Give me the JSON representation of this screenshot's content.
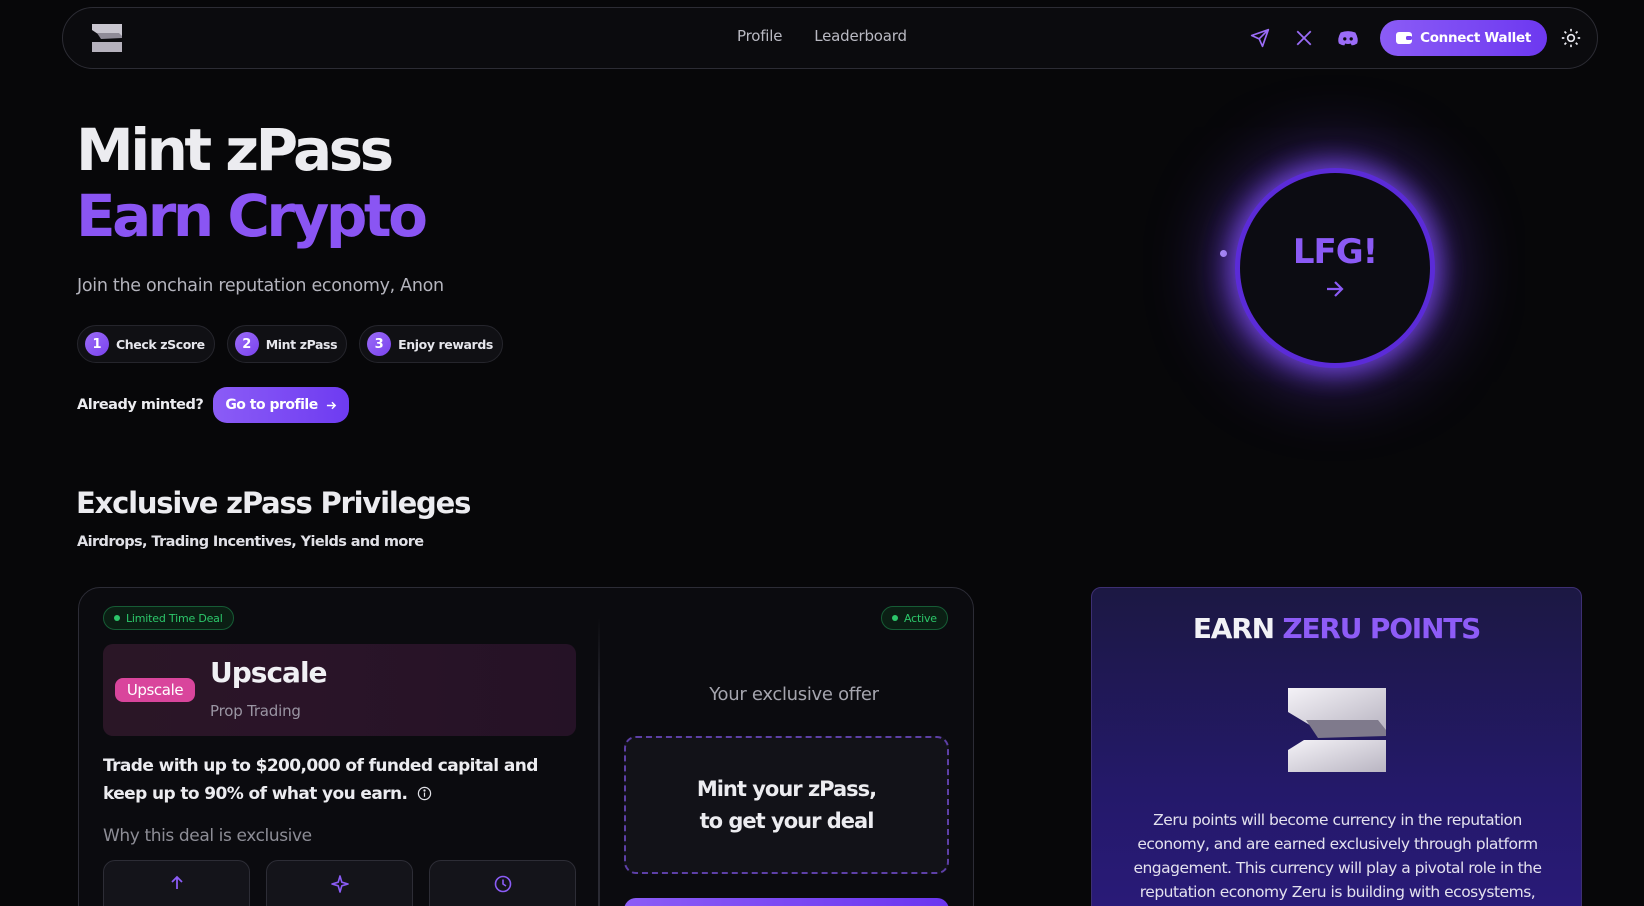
{
  "nav": {
    "links": [
      "Profile",
      "Leaderboard"
    ],
    "connect_label": "Connect Wallet"
  },
  "hero": {
    "title_line1": "Mint zPass",
    "title_line2": "Earn Crypto",
    "subtitle": "Join the onchain reputation economy, Anon",
    "steps": [
      {
        "num": "1",
        "label": "Check zScore"
      },
      {
        "num": "2",
        "label": "Mint zPass"
      },
      {
        "num": "3",
        "label": "Enjoy rewards"
      }
    ],
    "minted_text": "Already minted?",
    "goto_label": "Go to profile",
    "orb_label": "LFG!"
  },
  "privileges": {
    "title": "Exclusive zPass Privileges",
    "subtitle": "Airdrops, Trading Incentives, Yields and more"
  },
  "deal": {
    "badge_left": "Limited Time Deal",
    "badge_right": "Active",
    "partner_logo_alt": "Upscale",
    "partner_name": "Upscale",
    "partner_type": "Prop Trading",
    "description": "Trade with up to $200,000 of funded capital and keep up to 90% of what you earn.",
    "why_label": "Why this deal is exclusive",
    "offer_title": "Your exclusive offer",
    "offer_line1": "Mint your zPass,",
    "offer_line2": "to get your deal"
  },
  "zeru": {
    "title_part1": "EARN ",
    "title_part2": "ZERU POINTS",
    "description": "Zeru points will become currency in the reputation economy, and are earned exclusively through platform engagement. This currency will play a pivotal role in the reputation economy Zeru is building with ecosystems,"
  },
  "colors": {
    "accent": "#8b5cf6",
    "background": "#070709",
    "active_green": "#2cc76a"
  }
}
